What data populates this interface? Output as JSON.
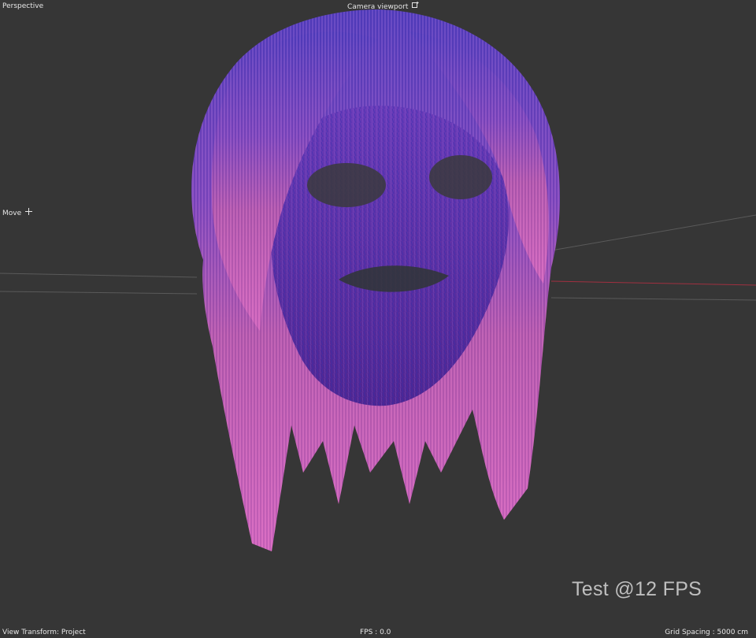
{
  "viewport": {
    "projection_label": "Perspective",
    "camera_label": "Camera viewport",
    "tool_label": "Move"
  },
  "status": {
    "view_transform": "View Transform: Project",
    "fps": "FPS : 0.0",
    "grid_spacing": "Grid Spacing : 5000 cm"
  },
  "overlay": {
    "test_caption": "Test @12 FPS"
  },
  "colors": {
    "background": "#363636",
    "hair_top": "#5a3fc0",
    "hair_bottom": "#d060b8",
    "face": "#5b2a9a",
    "axis_red": "#b03040"
  },
  "icons": {
    "camera": "camera-options-icon",
    "move": "move-cross-icon"
  }
}
